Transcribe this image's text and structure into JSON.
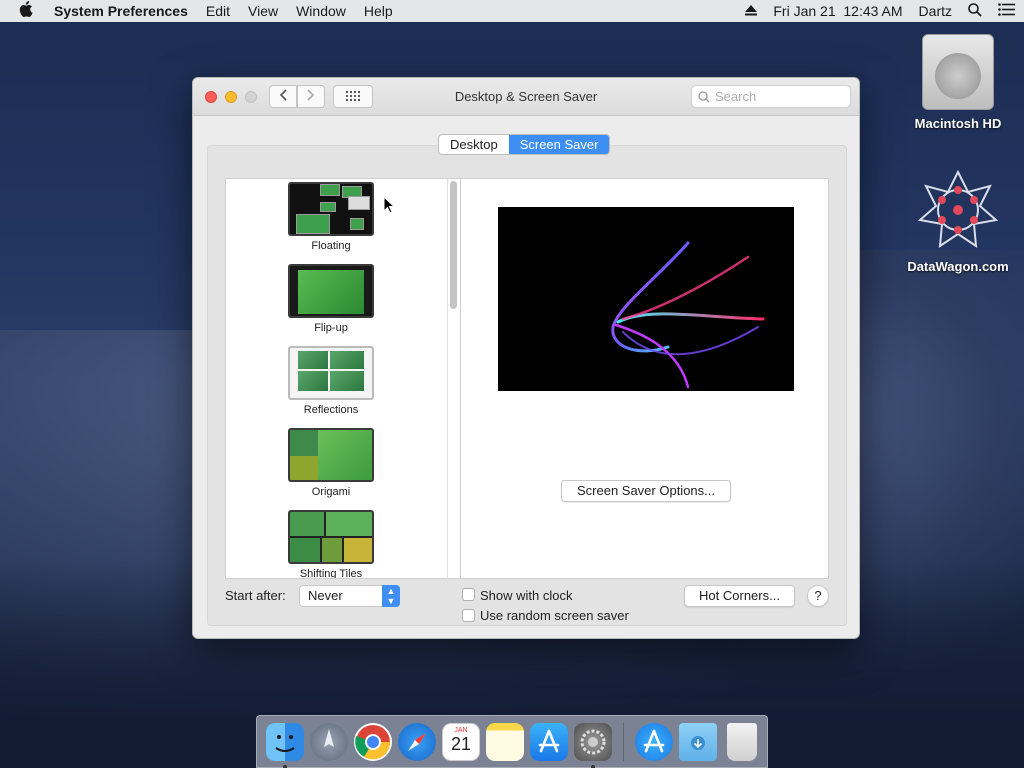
{
  "menubar": {
    "app_name": "System Preferences",
    "menus": [
      "Edit",
      "View",
      "Window",
      "Help"
    ],
    "datetime": "Fri Jan 21  12:43 AM",
    "user": "Dartz"
  },
  "desktop": {
    "icons": [
      {
        "label": "Macintosh HD",
        "icon": "hard-drive-icon"
      },
      {
        "label": "DataWagon.com",
        "icon": "datawagon-icon"
      }
    ]
  },
  "window": {
    "title": "Desktop & Screen Saver",
    "search_placeholder": "Search",
    "tabs": [
      {
        "label": "Desktop",
        "selected": false
      },
      {
        "label": "Screen Saver",
        "selected": true
      }
    ],
    "screen_savers": [
      {
        "label": "Floating"
      },
      {
        "label": "Flip-up"
      },
      {
        "label": "Reflections"
      },
      {
        "label": "Origami"
      },
      {
        "label": "Shifting Tiles"
      }
    ],
    "options_button": "Screen Saver Options...",
    "start_after_label": "Start after:",
    "start_after_value": "Never",
    "show_with_clock": {
      "label": "Show with clock",
      "checked": false
    },
    "random_saver": {
      "label": "Use random screen saver",
      "checked": false
    },
    "hot_corners_button": "Hot Corners...",
    "help_button": "?"
  },
  "dock": {
    "apps": [
      "finder-icon",
      "launchpad-icon",
      "chrome-icon",
      "safari-icon",
      "calendar-icon",
      "notes-icon",
      "app-store-icon",
      "system-preferences-icon"
    ],
    "calendar": {
      "month": "JAN",
      "day": "21"
    },
    "right": [
      "app-store-downloads-icon",
      "downloads-folder-icon",
      "trash-icon"
    ]
  },
  "colors": {
    "accent": "#3e8ff5",
    "close": "#fc5f57",
    "minimize": "#fdbc2e"
  }
}
